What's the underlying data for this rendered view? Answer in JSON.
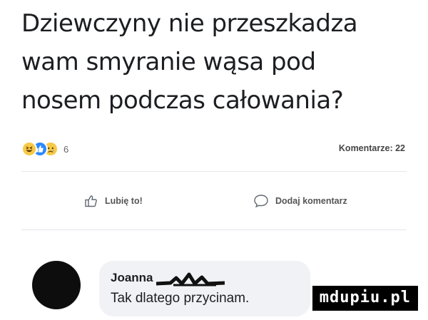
{
  "post": {
    "lines": [
      "Dziewczyny nie przeszkadza",
      "wam smyranie wąsa pod",
      "nosem podczas całowania?"
    ]
  },
  "stats": {
    "reaction_icons": [
      "haha-icon",
      "like-icon",
      "sad-icon"
    ],
    "reaction_count": "6",
    "comments_label": "Komentarze: 22"
  },
  "actions": {
    "like_label": "Lubię to!",
    "comment_label": "Dodaj komentarz"
  },
  "comment": {
    "author": "Joanna",
    "text": "Tak dlatego przycinam."
  },
  "watermark": "mdupiu.pl",
  "colors": {
    "text": "#1c1e21",
    "muted": "#65676b",
    "bubble": "#f0f2f5",
    "like_blue": "#2d88ff",
    "emoji_yellow": "#f7c948"
  }
}
